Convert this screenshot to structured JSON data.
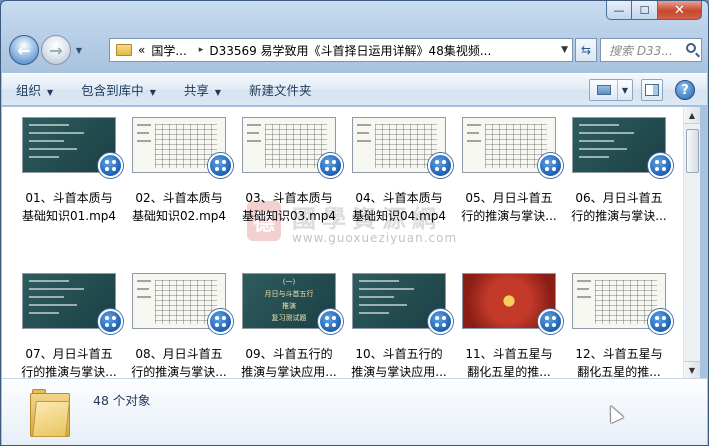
{
  "window": {
    "caption": {
      "minimize": "—",
      "maximize": "☐",
      "close": "✕"
    }
  },
  "nav": {
    "back_icon": "back-arrow-icon",
    "forward_icon": "forward-arrow-icon",
    "address": {
      "overflow": "«",
      "segments": [
        "国学...",
        "D33569 易学致用《斗首择日运用详解》48集视频..."
      ],
      "separator": "▸"
    },
    "search": {
      "placeholder": "搜索 D33..."
    }
  },
  "toolbar": {
    "organize": "组织",
    "include_in_library": "包含到库中",
    "share": "共享",
    "new_folder": "新建文件夹",
    "help": "?"
  },
  "files": [
    {
      "line1": "01、斗首本质与",
      "line2": "基础知识01.mp4",
      "style": "teal"
    },
    {
      "line1": "02、斗首本质与",
      "line2": "基础知识02.mp4",
      "style": "white"
    },
    {
      "line1": "03、斗首本质与",
      "line2": "基础知识03.mp4",
      "style": "white"
    },
    {
      "line1": "04、斗首本质与",
      "line2": "基础知识04.mp4",
      "style": "white"
    },
    {
      "line1": "05、月日斗首五",
      "line2": "行的推演与掌诀...",
      "style": "white"
    },
    {
      "line1": "06、月日斗首五",
      "line2": "行的推演与掌诀...",
      "style": "teal"
    },
    {
      "line1": "07、月日斗首五",
      "line2": "行的推演与掌诀...",
      "style": "teal"
    },
    {
      "line1": "08、月日斗首五",
      "line2": "行的推演与掌诀...",
      "style": "white"
    },
    {
      "line1": "09、斗首五行的",
      "line2": "推演与掌诀应用...",
      "style": "teal"
    },
    {
      "line1": "10、斗首五行的",
      "line2": "推演与掌诀应用...",
      "style": "teal"
    },
    {
      "line1": "11、斗首五星与",
      "line2": "翻化五星的推...",
      "style": "red"
    },
    {
      "line1": "12、斗首五星与",
      "line2": "翻化五星的推...",
      "style": "white"
    }
  ],
  "thumb_title_09": [
    "(一)",
    "月日与斗首五行",
    "推演",
    "复习测试题"
  ],
  "watermark": {
    "logo": "德",
    "text": "國學資源網",
    "url": "www.guoxueziyuan.com"
  },
  "details": {
    "count": "48 个对象"
  },
  "colors": {
    "accent": "#1e395b",
    "teal_thumb": "#2e5d5e",
    "badge_blue": "#1f5fb0"
  }
}
